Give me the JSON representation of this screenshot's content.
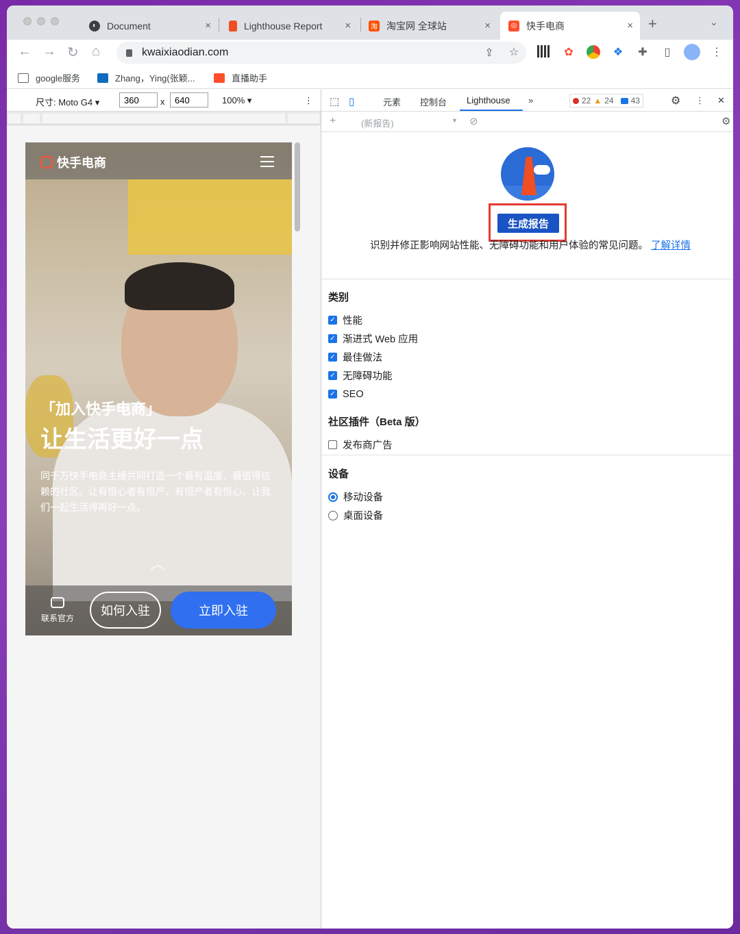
{
  "tabs": [
    {
      "title": "Document",
      "icon": "globe-icon",
      "close": "×"
    },
    {
      "title": "Lighthouse Report",
      "icon": "lighthouse-icon",
      "close": "×"
    },
    {
      "title": "淘宝网 全球站",
      "icon": "taobao-icon",
      "close": "×"
    },
    {
      "title": "快手电商",
      "icon": "kuaishou-icon",
      "close": "×",
      "active": true
    }
  ],
  "new_tab": "+",
  "tab_menu": "⌄",
  "address": {
    "url": "kwaixiaodian.com"
  },
  "bookmarks": [
    {
      "label": "google服务",
      "icon": "folder-icon"
    },
    {
      "label": "Zhang，Ying(张颖...",
      "icon": "outlook-icon"
    },
    {
      "label": "直播助手",
      "icon": "kuaishou-icon"
    }
  ],
  "device_toolbar": {
    "dimensions_label": "尺寸: Moto G4 ▾",
    "width": "360",
    "times": "x",
    "height": "640",
    "zoom": "100% ▾",
    "more": "⋮"
  },
  "phone_page": {
    "brand": "快手电商",
    "slogan1": "「加入快手电商」",
    "slogan2": "让生活更好一点",
    "description": "同千万快手电商主播共同打造一个最有温度、最值得信赖的社区。让有恒心者有恒产，有恒产者有恒心，让我们一起生活得再好一点。",
    "chevron": "︿",
    "contact": "联系官方",
    "how_to_join": "如何入驻",
    "join_now": "立即入驻"
  },
  "devtools": {
    "tabs": [
      "元素",
      "控制台",
      "Lighthouse"
    ],
    "more_tabs": "»",
    "errors": "22",
    "warnings": "24",
    "messages": "43",
    "new_report": "(新报告)",
    "add": "+",
    "close": "✕",
    "more": "⋮",
    "generate_button": "生成报告",
    "intro_text": "识别并修正影响网站性能、无障碍功能和用户体验的常见问题。",
    "learn_more": "了解详情",
    "categories_title": "类别",
    "categories": [
      "性能",
      "渐进式 Web 应用",
      "最佳做法",
      "无障碍功能",
      "SEO"
    ],
    "plugins_title": "社区插件（Beta 版）",
    "plugins": [
      "发布商广告"
    ],
    "device_title": "设备",
    "devices": [
      "移动设备",
      "桌面设备"
    ],
    "selected_device": "移动设备"
  },
  "colors": {
    "accent": "#1a73e8",
    "highlight_box": "#e33b2e",
    "brand": "#ff5033",
    "join_button": "#2f6ff0"
  }
}
